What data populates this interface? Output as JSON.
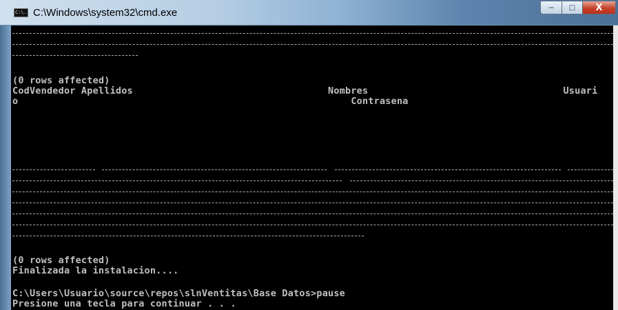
{
  "window": {
    "title": "C:\\Windows\\system32\\cmd.exe",
    "icon_text": "C:\\.",
    "controls": {
      "minimize": "─",
      "maximize": "□",
      "close": "X"
    }
  },
  "console": {
    "rows_affected_1": "(0 rows affected)",
    "header_line_1": "CodVendedor Apellidos                                  Nombres                                  Usuari",
    "header_line_2": "o                                                          Contrasena",
    "rows_affected_2": "(0 rows affected)",
    "finalizada": "Finalizada la instalacion....",
    "prompt_line": "C:\\Users\\Usuario\\source\\repos\\slnVentitas\\Base Datos>pause",
    "pause_message": "Presione una tecla para continuar . . ."
  },
  "colors": {
    "console_bg": "#000000",
    "console_text": "#c0c0c0",
    "close_button": "#c7412a"
  }
}
